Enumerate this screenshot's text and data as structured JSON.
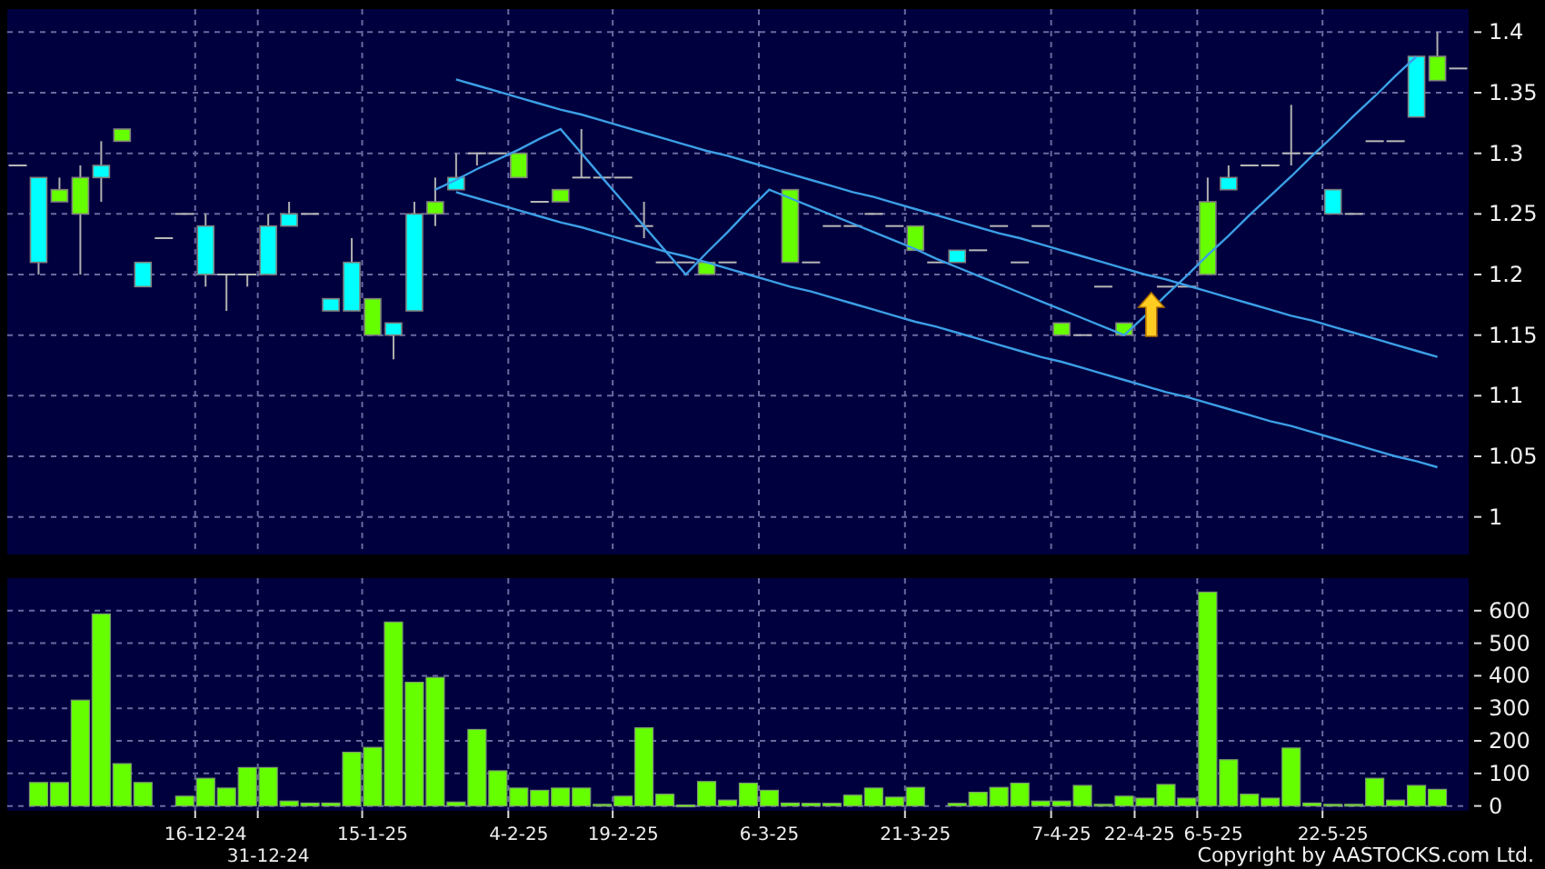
{
  "price_chart": {
    "chart_data": {
      "type": "line",
      "grid": true,
      "ylim": [
        0.969,
        1.419
      ],
      "yticks": [
        1,
        1.05,
        1.1,
        1.15,
        1.2,
        1.25,
        1.3,
        1.35,
        1.4
      ],
      "categories": [
        null,
        null,
        null,
        null,
        null,
        null,
        null,
        null,
        null,
        null,
        null,
        null,
        null,
        null,
        null,
        null,
        null,
        null,
        null,
        null,
        null,
        null,
        null,
        null,
        null,
        null,
        null,
        null,
        null,
        null,
        null,
        null,
        null,
        null,
        null,
        null,
        null,
        null,
        null,
        null,
        null,
        null,
        null,
        null,
        null,
        null,
        null,
        null,
        null,
        null,
        null,
        null,
        null,
        null,
        null,
        null,
        null,
        null,
        null,
        null,
        null,
        null,
        null,
        null,
        null,
        null,
        null,
        null,
        null,
        null
      ],
      "series": [
        {
          "color": "#3c9fe6",
          "values": [
            null,
            null,
            null,
            null,
            null,
            null,
            null,
            null,
            null,
            null,
            null,
            null,
            null,
            null,
            null,
            null,
            null,
            null,
            null,
            null,
            null,
            1.361,
            1.356,
            1.351,
            1.346,
            1.341,
            1.336,
            1.332,
            1.327,
            1.322,
            1.317,
            1.312,
            1.307,
            1.302,
            1.298,
            1.293,
            1.288,
            1.283,
            1.278,
            1.273,
            1.268,
            1.264,
            1.259,
            1.254,
            1.249,
            1.244,
            1.239,
            1.234,
            1.23,
            1.225,
            1.22,
            1.215,
            1.21,
            1.205,
            1.2,
            1.196,
            1.191,
            1.186,
            1.181,
            1.176,
            1.171,
            1.166,
            1.162,
            1.157,
            1.152,
            1.147,
            1.142,
            1.137,
            1.132,
            null
          ]
        },
        {
          "color": "#3c9fe6",
          "values": [
            null,
            null,
            null,
            null,
            null,
            null,
            null,
            null,
            null,
            null,
            null,
            null,
            null,
            null,
            null,
            null,
            null,
            null,
            null,
            null,
            null,
            1.268,
            1.263,
            1.258,
            1.253,
            1.248,
            1.243,
            1.239,
            1.234,
            1.229,
            1.224,
            1.219,
            1.215,
            1.21,
            1.205,
            1.2,
            1.195,
            1.19,
            1.186,
            1.181,
            1.176,
            1.171,
            1.166,
            1.161,
            1.157,
            1.152,
            1.147,
            1.142,
            1.137,
            1.132,
            1.128,
            1.123,
            1.118,
            1.113,
            1.108,
            1.103,
            1.099,
            1.094,
            1.089,
            1.084,
            1.079,
            1.075,
            1.07,
            1.065,
            1.06,
            1.055,
            1.05,
            1.046,
            1.041,
            null
          ]
        },
        {
          "color": "#3c9fe6",
          "values": [
            null,
            null,
            null,
            null,
            null,
            null,
            null,
            null,
            null,
            null,
            null,
            null,
            null,
            null,
            null,
            null,
            null,
            null,
            null,
            null,
            1.27,
            1.278,
            1.287,
            1.295,
            1.303,
            1.312,
            1.32,
            1.3,
            1.28,
            1.26,
            1.24,
            1.22,
            1.2,
            1.218,
            1.235,
            1.253,
            1.27,
            1.263,
            1.256,
            1.249,
            1.242,
            1.235,
            1.228,
            1.221,
            1.213,
            1.206,
            1.199,
            1.192,
            1.185,
            1.178,
            1.171,
            1.164,
            1.157,
            1.15,
            1.166,
            1.183,
            1.199,
            1.216,
            1.232,
            1.249,
            1.265,
            1.281,
            1.298,
            1.314,
            1.331,
            1.347,
            1.364,
            1.38,
            null,
            null
          ]
        }
      ]
    }
  },
  "volume_chart": {
    "chart_data": {
      "type": "bar",
      "grid": true,
      "ylim": [
        -15,
        700
      ],
      "yticks": [
        0,
        100,
        200,
        300,
        400,
        500,
        600
      ],
      "categories": [
        null,
        null,
        null,
        null,
        null,
        null,
        null,
        null,
        null,
        "16-12-24",
        null,
        null,
        "31-12-24",
        null,
        null,
        null,
        null,
        "15-1-25",
        null,
        null,
        null,
        null,
        null,
        null,
        "4-2-25",
        null,
        null,
        null,
        null,
        "19-2-25",
        null,
        null,
        null,
        null,
        null,
        null,
        "6-3-25",
        null,
        null,
        null,
        null,
        null,
        null,
        "21-3-25",
        null,
        null,
        null,
        null,
        null,
        null,
        "7-4-25",
        null,
        null,
        null,
        "22-4-25",
        null,
        null,
        "6-5-25",
        null,
        null,
        null,
        null,
        null,
        "22-5-25",
        null,
        null,
        null,
        null,
        null,
        null
      ],
      "series": [
        {
          "color": "#66ff00",
          "values": [
            null,
            72,
            72,
            325,
            590,
            130,
            72,
            null,
            30,
            85,
            55,
            118,
            118,
            15,
            9,
            9,
            165,
            180,
            565,
            380,
            395,
            12,
            235,
            108,
            55,
            48,
            55,
            55,
            5,
            30,
            240,
            36,
            3,
            75,
            18,
            70,
            48,
            9,
            8,
            8,
            33,
            55,
            27,
            57,
            null,
            8,
            42,
            57,
            70,
            15,
            15,
            63,
            5,
            30,
            24,
            66,
            24,
            657,
            142,
            36,
            24,
            178,
            9,
            5,
            5,
            85,
            18,
            63,
            51,
            null
          ]
        }
      ]
    }
  },
  "copyright": "Copyright by AASTOCKS.com Ltd."
}
